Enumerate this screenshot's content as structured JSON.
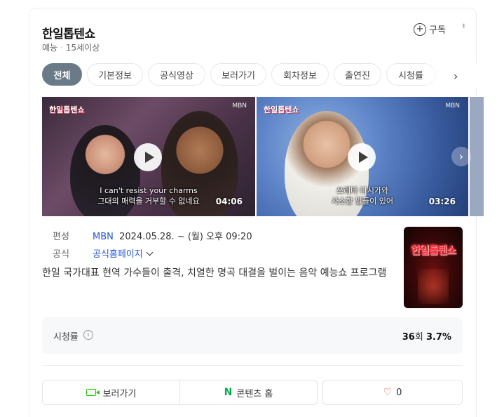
{
  "header": {
    "title": "한일톱텐쇼",
    "genre": "예능",
    "rating_age": "15세이상",
    "subscribe_label": "구독",
    "more_icon": "more-vertical-icon"
  },
  "tabs": [
    {
      "label": "전체",
      "active": true
    },
    {
      "label": "기본정보",
      "active": false
    },
    {
      "label": "공식영상",
      "active": false
    },
    {
      "label": "보러가기",
      "active": false
    },
    {
      "label": "회차정보",
      "active": false
    },
    {
      "label": "출연진",
      "active": false
    },
    {
      "label": "시청률",
      "active": false
    }
  ],
  "videos": [
    {
      "show_logo": "한일톱텐쇼",
      "channel": "MBN",
      "caption_line1": "I can't resist your charms",
      "caption_line2": "그대의 매력을 거부할 수 없네요",
      "duration": "04:06"
    },
    {
      "show_logo": "한일톱텐쇼",
      "channel": "MBN",
      "caption_line1": "쓰레타 다시가와",
      "caption_line2": "사소한 말들이 있어",
      "duration": "03:26"
    }
  ],
  "info": {
    "broadcast_label": "편성",
    "channel": "MBN",
    "schedule": "2024.05.28. ~ (월) 오후 09:20",
    "official_label": "공식",
    "official_link": "공식홈페이지"
  },
  "description": "한일 국가대표 현역 가수들이 출격, 치열한 명곡 대결을 벌이는 음악 예능쇼 프로그램",
  "poster": {
    "logo_text": "한일톱텐쇼"
  },
  "ratings": {
    "label": "시청률",
    "episode": "36",
    "episode_suffix": "회",
    "percent": "3.7%"
  },
  "actions": {
    "watch_label": "보러가기",
    "home_label": "콘텐츠 홈",
    "like_count": "0"
  },
  "colors": {
    "link": "#2355d8",
    "active_tab": "#6b7a87",
    "naver_green": "#03a94d",
    "heart": "#e74c3c"
  }
}
